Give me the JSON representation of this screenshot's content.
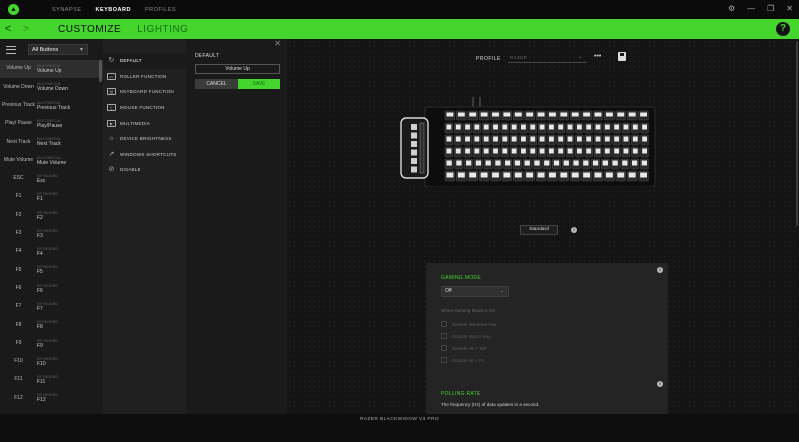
{
  "top_tabs": [
    "SYNAPSE",
    "KEYBOARD",
    "PROFILES"
  ],
  "window_controls": {
    "settings": "⚙",
    "minimize": "—",
    "maximize": "❐",
    "close": "✕"
  },
  "nav": {
    "back": "<",
    "forward": ">",
    "tabs": [
      "CUSTOMIZE",
      "LIGHTING"
    ],
    "help": "?"
  },
  "key_list": {
    "filter": "All Buttons",
    "keys": [
      {
        "name": "Volume Up",
        "category": "MULTIMEDIA",
        "value": "Volume Up"
      },
      {
        "name": "Volume Down",
        "category": "MULTIMEDIA",
        "value": "Volume Down"
      },
      {
        "name": "Previous Track",
        "category": "MULTIMEDIA",
        "value": "Previous Track"
      },
      {
        "name": "Play/ Pause",
        "category": "MULTIMEDIA",
        "value": "Play/Pause"
      },
      {
        "name": "Next Track",
        "category": "MULTIMEDIA",
        "value": "Next Track"
      },
      {
        "name": "Mute Volume",
        "category": "MULTIMEDIA",
        "value": "Mute Volume"
      },
      {
        "name": "ESC",
        "category": "KEYBOARD",
        "value": "Esc"
      },
      {
        "name": "F1",
        "category": "KEYBOARD",
        "value": "F1"
      },
      {
        "name": "F2",
        "category": "KEYBOARD",
        "value": "F2"
      },
      {
        "name": "F3",
        "category": "KEYBOARD",
        "value": "F3"
      },
      {
        "name": "F4",
        "category": "KEYBOARD",
        "value": "F4"
      },
      {
        "name": "F5",
        "category": "KEYBOARD",
        "value": "F5"
      },
      {
        "name": "F6",
        "category": "KEYBOARD",
        "value": "F6"
      },
      {
        "name": "F7",
        "category": "KEYBOARD",
        "value": "F7"
      },
      {
        "name": "F8",
        "category": "KEYBOARD",
        "value": "F8"
      },
      {
        "name": "F9",
        "category": "KEYBOARD",
        "value": "F9"
      },
      {
        "name": "F10",
        "category": "KEYBOARD",
        "value": "F10"
      },
      {
        "name": "F11",
        "category": "KEYBOARD",
        "value": "F11"
      },
      {
        "name": "F12",
        "category": "KEYBOARD",
        "value": "F12"
      }
    ]
  },
  "functions": [
    {
      "label": "DEFAULT",
      "icon": "refresh-icon",
      "glyph": "↻"
    },
    {
      "label": "ROLLER FUNCTION",
      "icon": "roller-icon",
      "glyph": "▭"
    },
    {
      "label": "KEYBOARD FUNCTION",
      "icon": "keyboard-icon",
      "glyph": "▤"
    },
    {
      "label": "MOUSE FUNCTION",
      "icon": "mouse-icon",
      "glyph": "▯"
    },
    {
      "label": "MULTIMEDIA",
      "icon": "multimedia-icon",
      "glyph": "▶"
    },
    {
      "label": "DEVICE BRIGHTNESS",
      "icon": "brightness-icon",
      "glyph": "☼"
    },
    {
      "label": "WINDOWS SHORTCUTS",
      "icon": "shortcut-arrow-icon",
      "glyph": "↗"
    },
    {
      "label": "DISABLE",
      "icon": "disable-icon",
      "glyph": "⊘"
    }
  ],
  "detail": {
    "title": "DEFAULT",
    "close": "✕",
    "value": "Volume Up",
    "cancel": "CANCEL",
    "save": "SAVE"
  },
  "profile": {
    "label": "PROFILE",
    "selected": "RAZER",
    "more": "•••"
  },
  "standard_button": "Standard",
  "gaming_mode": {
    "info": "i",
    "title": "GAMING MODE",
    "selected": "Off",
    "subtitle": "When Gaming Mode is On",
    "options": [
      "Disable Windows Key",
      "Disable Macro Key",
      "Disable Alt + Tab",
      "Disable Alt + F4"
    ]
  },
  "polling_rate": {
    "info": "i",
    "title": "POLLING RATE",
    "description": "The frequency (Hz) of data updates in a second."
  },
  "device_name": "RAZER BLACKWIDOW V3 PRO",
  "colors": {
    "accent": "#44d62c",
    "background": "#111111"
  }
}
